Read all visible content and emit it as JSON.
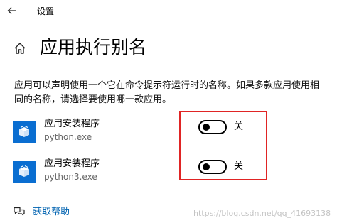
{
  "window": {
    "title": "设置"
  },
  "page": {
    "title": "应用执行别名",
    "description": "应用可以声明使用一个它在命令提示符运行时的名称。如果多款应用使用相同的名称，请选择要使用哪一款应用。"
  },
  "apps": [
    {
      "name": "应用安装程序",
      "exe": "python.exe",
      "toggle_state": "关",
      "enabled": false,
      "icon": "package-box-icon"
    },
    {
      "name": "应用安装程序",
      "exe": "python3.exe",
      "toggle_state": "关",
      "enabled": false,
      "icon": "package-box-icon"
    }
  ],
  "help": {
    "label": "获取帮助",
    "icon": "chat-bubbles-icon"
  },
  "watermark": "https://blog.csdn.net/qq_41693138",
  "colors": {
    "accent": "#0063b1",
    "app_icon_bg": "#0a6ed1",
    "highlight": "#e02424"
  }
}
